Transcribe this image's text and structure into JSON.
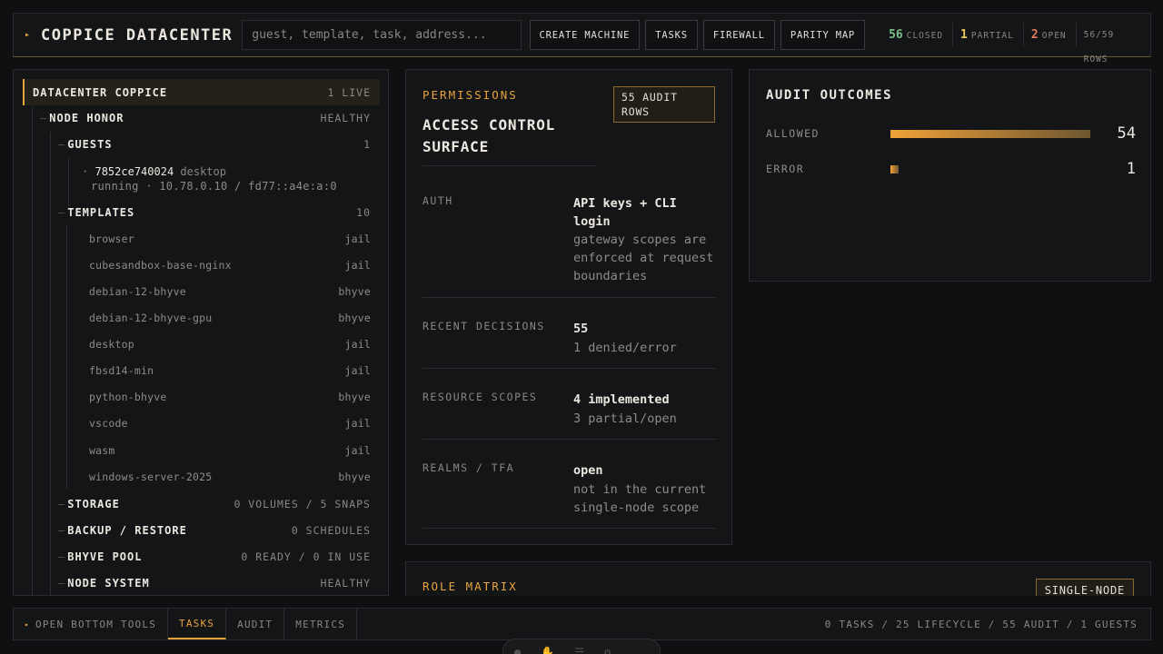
{
  "header": {
    "title": "COPPICE DATACENTER",
    "search_placeholder": "guest, template, task, address...",
    "buttons": [
      "CREATE MACHINE",
      "TASKS",
      "FIREWALL",
      "PARITY MAP"
    ],
    "stats": [
      {
        "value": "56",
        "label": "CLOSED",
        "color": "#7cc08a"
      },
      {
        "value": "1",
        "label": "PARTIAL",
        "color": "#e8c85a"
      },
      {
        "value": "2",
        "label": "OPEN",
        "color": "#e07a5a"
      }
    ],
    "rows": "56/59 ROWS"
  },
  "tree": {
    "root": {
      "label": "DATACENTER COPPICE",
      "value": "1 LIVE"
    },
    "node": {
      "label": "NODE HONOR",
      "value": "HEALTHY"
    },
    "guests": {
      "label": "GUESTS",
      "value": "1"
    },
    "guest": {
      "id": "7852ce740024",
      "kind": "desktop",
      "detail": "running · 10.78.0.10 / fd77::a4e:a:0"
    },
    "templates": {
      "label": "TEMPLATES",
      "value": "10"
    },
    "template_items": [
      {
        "name": "browser",
        "type": "jail"
      },
      {
        "name": "cubesandbox-base-nginx",
        "type": "jail"
      },
      {
        "name": "debian-12-bhyve",
        "type": "bhyve"
      },
      {
        "name": "debian-12-bhyve-gpu",
        "type": "bhyve"
      },
      {
        "name": "desktop",
        "type": "jail"
      },
      {
        "name": "fbsd14-min",
        "type": "jail"
      },
      {
        "name": "python-bhyve",
        "type": "bhyve"
      },
      {
        "name": "vscode",
        "type": "jail"
      },
      {
        "name": "wasm",
        "type": "jail"
      },
      {
        "name": "windows-server-2025",
        "type": "bhyve"
      }
    ],
    "storage": {
      "label": "STORAGE",
      "value": "0 VOLUMES / 5 SNAPS"
    },
    "backup": {
      "label": "BACKUP / RESTORE",
      "value": "0 SCHEDULES"
    },
    "bhyve_pool": {
      "label": "BHYVE POOL",
      "value": "0 READY / 0 IN USE"
    },
    "node_system": {
      "label": "NODE SYSTEM",
      "value": "HEALTHY"
    }
  },
  "permissions": {
    "eyebrow": "PERMISSIONS",
    "title": "ACCESS CONTROL SURFACE",
    "badge": "55 AUDIT ROWS",
    "rows": [
      {
        "key": "AUTH",
        "value": "API keys + CLI login",
        "sub": "gateway scopes are enforced at request boundaries"
      },
      {
        "key": "RECENT DECISIONS",
        "value": "55",
        "sub": "1 denied/error"
      },
      {
        "key": "RESOURCE SCOPES",
        "value": "4 implemented",
        "sub": "3 partial/open"
      },
      {
        "key": "REALMS / TFA",
        "value": "open",
        "sub": "not in the current single-node scope"
      }
    ]
  },
  "audit": {
    "title": "AUDIT OUTCOMES",
    "rows": [
      {
        "label": "ALLOWED",
        "count": "54",
        "fraction": 1.0
      },
      {
        "label": "ERROR",
        "count": "1",
        "fraction": 0.0185
      }
    ]
  },
  "role_matrix": {
    "eyebrow": "ROLE MATRIX",
    "badge": "SINGLE-NODE"
  },
  "bottom": {
    "open_tools": "OPEN BOTTOM TOOLS",
    "tabs": [
      "TASKS",
      "AUDIT",
      "METRICS"
    ],
    "active_tab": "TASKS",
    "summary": "0 TASKS / 25 LIFECYCLE / 55 AUDIT / 1 GUESTS"
  },
  "colors": {
    "accent": "#e8a23c",
    "closed": "#7cc08a",
    "partial": "#e8c85a",
    "open": "#e07a5a"
  }
}
